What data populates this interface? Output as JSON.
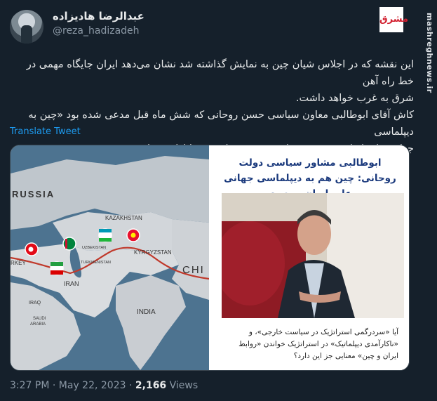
{
  "author": {
    "display_name": "عبدالرضا هادیزاده",
    "handle": "@reza_hadizadeh"
  },
  "branding": {
    "logo_text": "مشرق",
    "watermark": "mashreghnews.ir"
  },
  "tweet": {
    "lines": [
      "این نقشه که در اجلاس شیان چین به نمایش گذاشته شد نشان می‌دهد ایران جایگاه مهمی در خط راه آهن",
      "شرق به غرب خواهد داشت.",
      "کاش آقای ابوطالبی معاون سیاسی حسن روحانی که شش ماه قبل مدعی شده بود «چین به دیپلماسی",
      "جهانی علیه ایران پیوسته» در این خصوص نظر خود را ارائه میداد"
    ],
    "translate_label": "Translate Tweet"
  },
  "map": {
    "labels": {
      "russia": "RUSSIA",
      "kazakhstan": "KAZAKHSTAN",
      "uzbekistan": "UZBEKISTAN",
      "turkmenistan": "TURKMENISTAN",
      "kyrgyzstan": "KYRGYZSTAN",
      "turkey": "RKEY",
      "iran": "IRAN",
      "iraq": "IRAQ",
      "saudi": "SAUDI\nARABIA",
      "india": "INDIA",
      "china": "CHI"
    }
  },
  "news_card": {
    "title": "ابوطالبی مشاور سیاسی دولت روحانی: چین هم به دیپلماسی جهانی علیه ایران پیوست",
    "caption": "آیا «سردرگمی استراتژیک در سیاست خارجی»، و «ناکارآمدی دیپلماتیک» در استراتژیک خواندن «روابط ایران و چین» معنایی جز این دارد؟"
  },
  "footer": {
    "time": "3:27 PM",
    "separator": "·",
    "date": "May 22, 2023",
    "views_count": "2,166",
    "views_label": "Views"
  },
  "colors": {
    "background": "#15202b",
    "link": "#1d9bf0",
    "muted": "#8b98a5",
    "route": "#c0392b",
    "news_title": "#1b3a7d"
  }
}
